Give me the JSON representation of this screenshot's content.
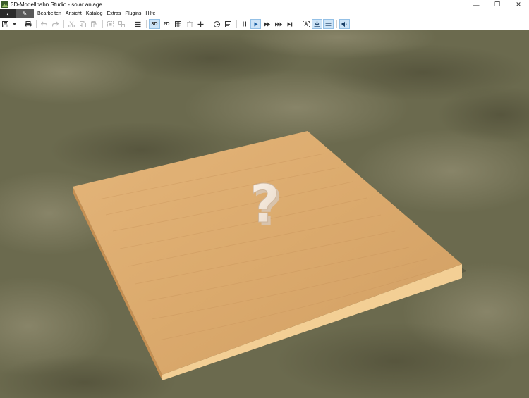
{
  "window": {
    "title": "3D-Modellbahn Studio - solar anlage",
    "controls": {
      "minimize": "—",
      "restore": "❐",
      "close": "✕"
    }
  },
  "menu": {
    "back_icon": "‹",
    "edit_icon": "✎",
    "items": [
      "Bearbeiten",
      "Ansicht",
      "Katalog",
      "Extras",
      "Plugins",
      "Hilfe"
    ]
  },
  "toolbar": {
    "view_3d": "3D",
    "view_2d": "2D",
    "icons": [
      "save-icon",
      "save-dropdown-icon",
      "print-icon",
      "undo-icon",
      "redo-icon",
      "cut-icon",
      "copy-icon",
      "paste-icon",
      "group-icon",
      "ungroup-icon",
      "layers-icon",
      "view-3d-icon",
      "view-2d-icon",
      "grid-icon",
      "trash-icon",
      "add-icon",
      "clock-icon",
      "panel-icon",
      "pause-icon",
      "play-icon",
      "fast-forward-icon",
      "faster-forward-icon",
      "step-icon",
      "text-label-icon",
      "download-icon",
      "lines-icon",
      "sound-icon"
    ]
  },
  "scene": {
    "placeholder_symbol": "?",
    "ground_color": "#6b6a4e",
    "board_top_color": "#deb075",
    "board_edge_color": "#f3cf95"
  }
}
